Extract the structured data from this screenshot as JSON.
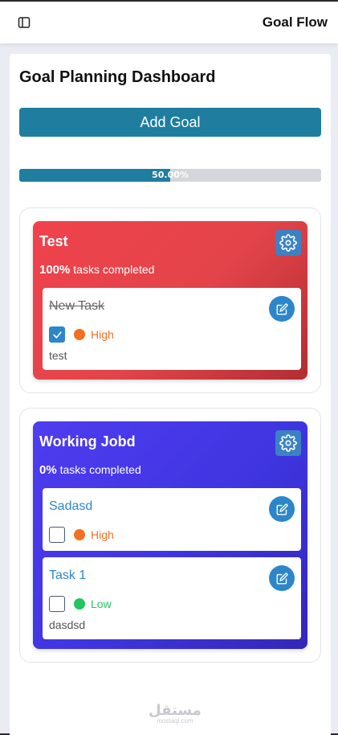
{
  "header": {
    "app_title": "Goal Flow",
    "sidebar_icon": "sidebar-toggle-icon"
  },
  "dashboard": {
    "title": "Goal Planning Dashboard",
    "add_goal_label": "Add Goal",
    "progress": {
      "value": 0.5,
      "label": "50.00%"
    }
  },
  "goals": [
    {
      "title": "Test",
      "percent": "100%",
      "stat_suffix": " tasks completed",
      "color": "#e8434b",
      "tasks": [
        {
          "title": "New Task",
          "done": true,
          "priority": "High",
          "priority_color": "#f36f21",
          "description": "test"
        }
      ]
    },
    {
      "title": "Working Jobd",
      "percent": "0%",
      "stat_suffix": " tasks completed",
      "color": "#4338e8",
      "tasks": [
        {
          "title": "Sadasd",
          "done": false,
          "priority": "High",
          "priority_color": "#f36f21",
          "description": ""
        },
        {
          "title": "Task 1",
          "done": false,
          "priority": "Low",
          "priority_color": "#22c55e",
          "description": "dasdsd"
        }
      ]
    }
  ],
  "watermark": {
    "arabic": "مستقل",
    "latin": "mostaql.com"
  }
}
